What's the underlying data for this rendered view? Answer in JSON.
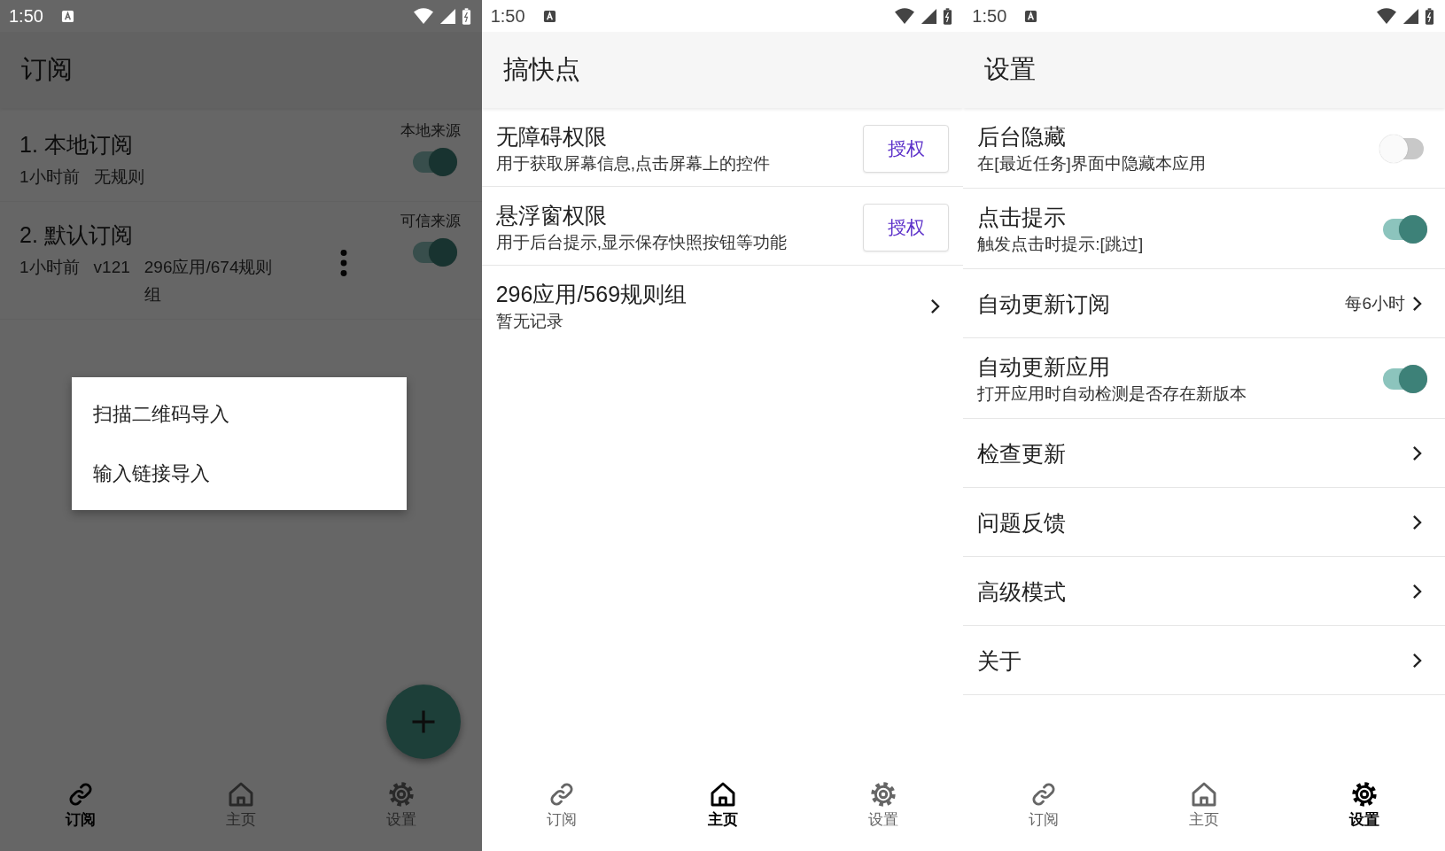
{
  "screens": [
    {
      "kind": "subscriptions",
      "dimmed": true,
      "status_bar": {
        "time": "1:50"
      },
      "title": "订阅",
      "subscriptions": [
        {
          "name": "1. 本地订阅",
          "source": "本地来源",
          "meta": [
            "1小时前",
            "无规则"
          ],
          "on": true,
          "has_menu": false
        },
        {
          "name": "2. 默认订阅",
          "source": "可信来源",
          "meta": [
            "1小时前",
            "v121",
            "296应用/674规则组"
          ],
          "on": true,
          "has_menu": true
        }
      ],
      "popup_menu": [
        "扫描二维码导入",
        "输入链接导入"
      ],
      "bottom_nav": [
        {
          "label": "订阅",
          "selected": true
        },
        {
          "label": "主页",
          "selected": false
        },
        {
          "label": "设置",
          "selected": false
        }
      ]
    },
    {
      "kind": "home",
      "dimmed": false,
      "status_bar": {
        "time": "1:50"
      },
      "title": "搞快点",
      "permissions": [
        {
          "title": "无障碍权限",
          "description": "用于获取屏幕信息,点击屏幕上的控件",
          "button": "授权"
        },
        {
          "title": "悬浮窗权限",
          "description": "用于后台提示,显示保存快照按钮等功能",
          "button": "授权"
        }
      ],
      "summary": {
        "title": "296应用/569规则组",
        "subtitle": "暂无记录"
      },
      "bottom_nav": [
        {
          "label": "订阅",
          "selected": false
        },
        {
          "label": "主页",
          "selected": true
        },
        {
          "label": "设置",
          "selected": false
        }
      ]
    },
    {
      "kind": "settings",
      "dimmed": false,
      "status_bar": {
        "time": "1:50"
      },
      "title": "设置",
      "settings": [
        {
          "kind": "switch",
          "title": "后台隐藏",
          "description": "在[最近任务]界面中隐藏本应用",
          "on": false
        },
        {
          "kind": "switch",
          "title": "点击提示",
          "description": "触发点击时提示:[跳过]",
          "on": true
        },
        {
          "kind": "value",
          "title": "自动更新订阅",
          "value": "每6小时"
        },
        {
          "kind": "switch",
          "title": "自动更新应用",
          "description": "打开应用时自动检测是否存在新版本",
          "on": true
        },
        {
          "kind": "link",
          "title": "检查更新"
        },
        {
          "kind": "link",
          "title": "问题反馈"
        },
        {
          "kind": "link",
          "title": "高级模式"
        },
        {
          "kind": "link",
          "title": "关于"
        }
      ],
      "bottom_nav": [
        {
          "label": "订阅",
          "selected": false
        },
        {
          "label": "主页",
          "selected": false
        },
        {
          "label": "设置",
          "selected": true
        }
      ]
    }
  ]
}
